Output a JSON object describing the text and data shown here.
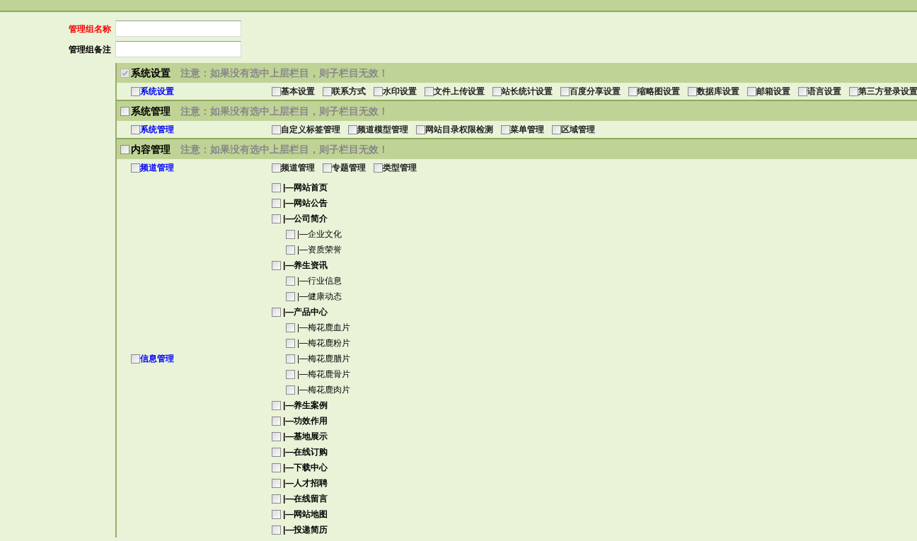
{
  "form": {
    "fields": [
      {
        "label": "管理组名称",
        "required": true
      },
      {
        "label": "管理组备注",
        "required": false
      }
    ]
  },
  "groups": [
    {
      "title": "系统设置",
      "checked": true,
      "notice": "注意：如果没有选中上层栏目，则子栏目无效！",
      "rows": [
        {
          "kind": "inline",
          "label": "系统设置",
          "checked": false,
          "items": [
            {
              "label": "基本设置",
              "checked": false
            },
            {
              "label": "联系方式",
              "checked": false
            },
            {
              "label": "水印设置",
              "checked": false
            },
            {
              "label": "文件上传设置",
              "checked": false
            },
            {
              "label": "站长统计设置",
              "checked": false
            },
            {
              "label": "百度分享设置",
              "checked": false
            },
            {
              "label": "缩略图设置",
              "checked": false
            },
            {
              "label": "数据库设置",
              "checked": false
            },
            {
              "label": "邮箱设置",
              "checked": false
            },
            {
              "label": "语言设置",
              "checked": false
            },
            {
              "label": "第三方登录设置",
              "checked": false
            }
          ]
        }
      ]
    },
    {
      "title": "系统管理",
      "checked": false,
      "notice": "注意：如果没有选中上层栏目，则子栏目无效！",
      "rows": [
        {
          "kind": "inline",
          "label": "系统管理",
          "checked": false,
          "items": [
            {
              "label": "自定义标签管理",
              "checked": false
            },
            {
              "label": "频道模型管理",
              "checked": false
            },
            {
              "label": "网站目录权限检测",
              "checked": false
            },
            {
              "label": "菜单管理",
              "checked": false
            },
            {
              "label": "区域管理",
              "checked": false
            }
          ]
        }
      ]
    },
    {
      "title": "内容管理",
      "checked": false,
      "notice": "注意：如果没有选中上层栏目，则子栏目无效！",
      "rows": [
        {
          "kind": "inline",
          "label": "频道管理",
          "checked": false,
          "items": [
            {
              "label": "频道管理",
              "checked": false
            },
            {
              "label": "专题管理",
              "checked": false
            },
            {
              "label": "类型管理",
              "checked": false
            }
          ]
        },
        {
          "kind": "tree",
          "label": "信息管理",
          "checked": false,
          "items": [
            {
              "label": "|—网站首页",
              "checked": false
            },
            {
              "label": "|—网站公告",
              "checked": false
            },
            {
              "label": "|—公司简介",
              "checked": false,
              "children": [
                {
                  "label": "|—企业文化",
                  "checked": false
                },
                {
                  "label": "|—资质荣誉",
                  "checked": false
                }
              ]
            },
            {
              "label": "|—养生资讯",
              "checked": false,
              "children": [
                {
                  "label": "|—行业信息",
                  "checked": false
                },
                {
                  "label": "|—健康动态",
                  "checked": false
                }
              ]
            },
            {
              "label": "|—产品中心",
              "checked": false,
              "children": [
                {
                  "label": "|—梅花鹿血片",
                  "checked": false
                },
                {
                  "label": "|—梅花鹿粉片",
                  "checked": false
                },
                {
                  "label": "|—梅花鹿腊片",
                  "checked": false
                },
                {
                  "label": "|—梅花鹿骨片",
                  "checked": false
                },
                {
                  "label": "|—梅花鹿肉片",
                  "checked": false
                }
              ]
            },
            {
              "label": "|—养生案例",
              "checked": false
            },
            {
              "label": "|—功效作用",
              "checked": false
            },
            {
              "label": "|—基地展示",
              "checked": false
            },
            {
              "label": "|—在线订购",
              "checked": false
            },
            {
              "label": "|—下载中心",
              "checked": false
            },
            {
              "label": "|—人才招聘",
              "checked": false
            },
            {
              "label": "|—在线留言",
              "checked": false
            },
            {
              "label": "|—网站地图",
              "checked": false
            },
            {
              "label": "|—投递简历",
              "checked": false
            }
          ]
        }
      ]
    }
  ]
}
